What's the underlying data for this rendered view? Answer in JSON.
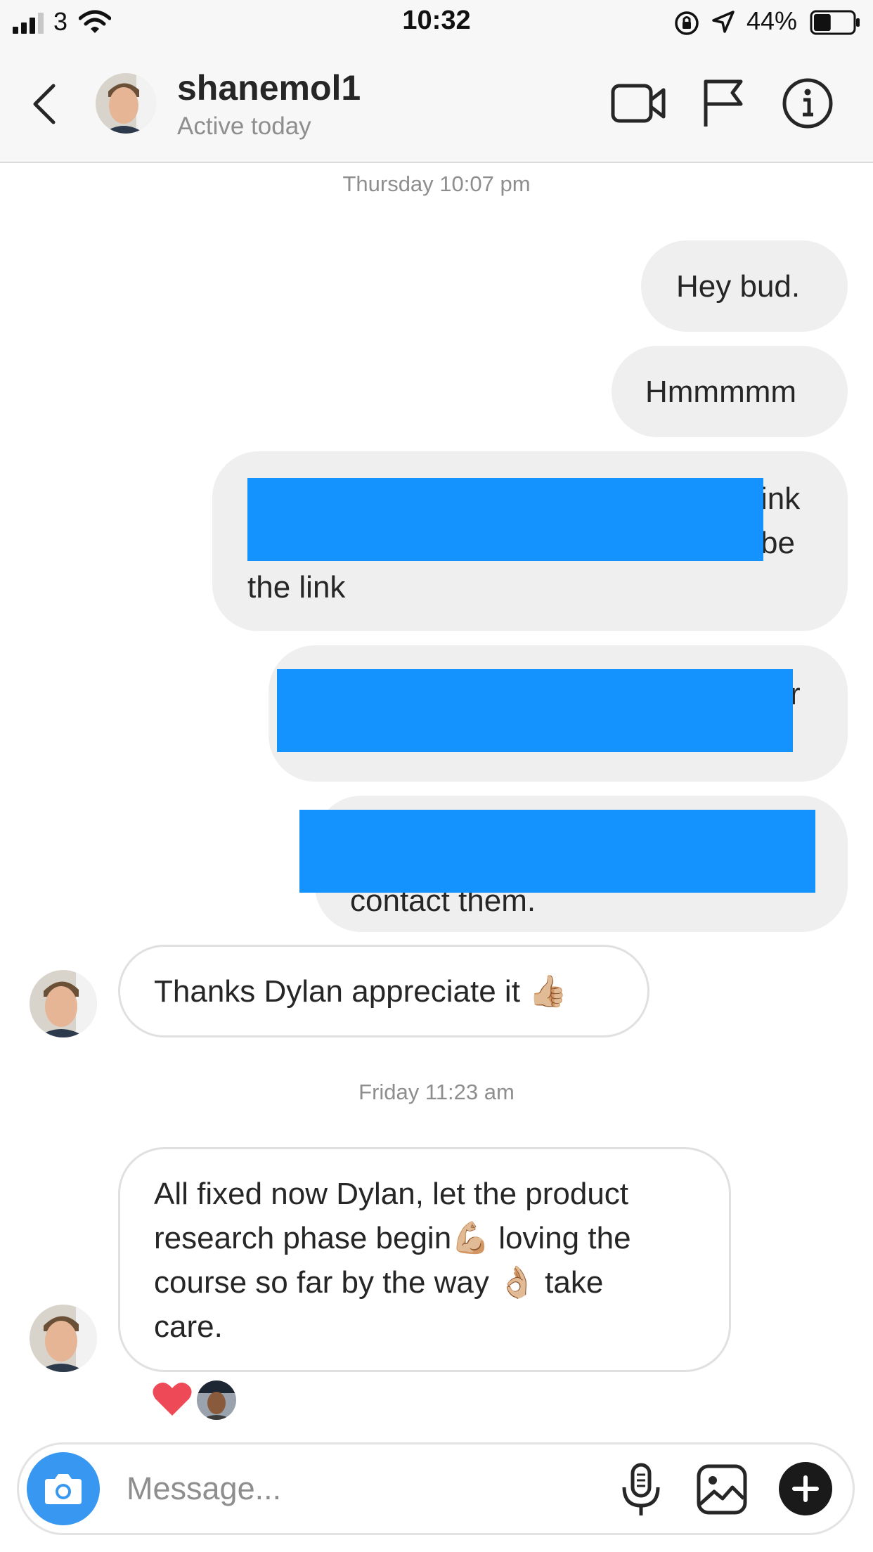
{
  "status_bar": {
    "carrier": "3",
    "time": "10:32",
    "battery": "44%",
    "battery_level": 0.44
  },
  "header": {
    "username": "shanemol1",
    "status": "Active today",
    "icons": [
      "back-arrow-icon",
      "video-call-icon",
      "flag-icon",
      "info-icon"
    ]
  },
  "thread": {
    "timestamp_1": "Thursday 10:07 pm",
    "outgoing": [
      {
        "text": "Hey bud."
      },
      {
        "text": "Hmmmmm"
      },
      {
        "line1": "ink",
        "line2": "be",
        "line3": "the link"
      },
      {
        "visible_fragment": "r"
      },
      {
        "visible_fragment": "contact them."
      }
    ],
    "incoming_1": {
      "text": "Thanks Dylan appreciate it 👍🏼"
    },
    "timestamp_2": "Friday 11:23 am",
    "incoming_2": {
      "line1": "All fixed now Dylan, let the product",
      "line2": "research phase begin💪🏼 loving the",
      "line3": "course so far by the way 👌🏼 take",
      "line4": "care."
    },
    "reaction": "heart-icon"
  },
  "composer": {
    "placeholder": "Message...",
    "icons": [
      "camera-icon",
      "microphone-icon",
      "gallery-icon",
      "plus-icon"
    ]
  },
  "colors": {
    "redaction": "#1493ff",
    "outgoing_bubble": "#efefef",
    "camera_button": "#3897f0"
  }
}
